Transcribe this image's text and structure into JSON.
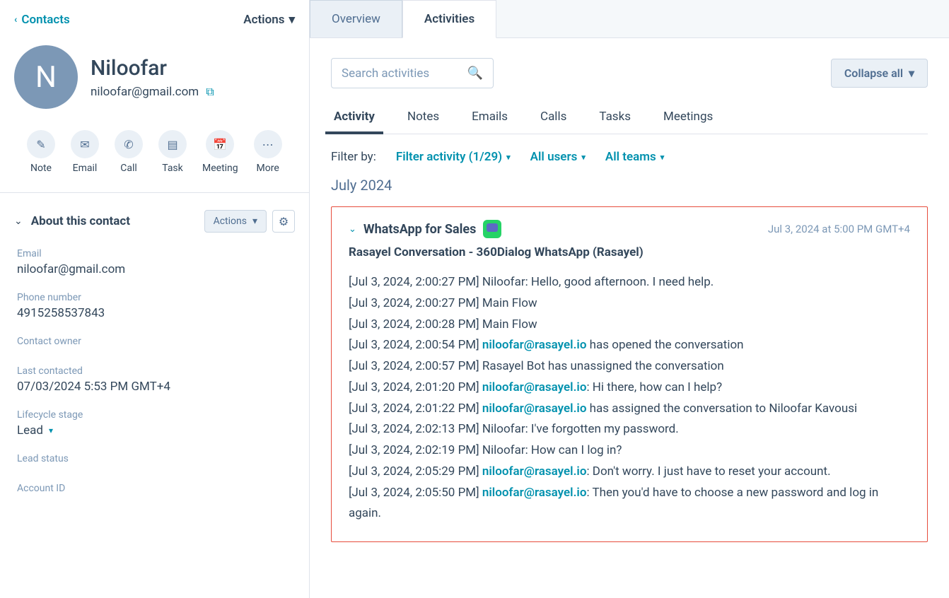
{
  "sidebar": {
    "back_label": "Contacts",
    "actions_label": "Actions",
    "avatar_letter": "N",
    "contact_name": "Niloofar",
    "contact_email": "niloofar@gmail.com",
    "action_buttons": [
      {
        "label": "Note",
        "icon": "✎"
      },
      {
        "label": "Email",
        "icon": "✉"
      },
      {
        "label": "Call",
        "icon": "✆"
      },
      {
        "label": "Task",
        "icon": "▤"
      },
      {
        "label": "Meeting",
        "icon": "📅"
      },
      {
        "label": "More",
        "icon": "⋯"
      }
    ],
    "about": {
      "title": "About this contact",
      "actions_label": "Actions",
      "fields": {
        "email_label": "Email",
        "email_value": "niloofar@gmail.com",
        "phone_label": "Phone number",
        "phone_value": "4915258537843",
        "owner_label": "Contact owner",
        "owner_value": "",
        "last_contacted_label": "Last contacted",
        "last_contacted_value": "07/03/2024 5:53 PM GMT+4",
        "lifecycle_label": "Lifecycle stage",
        "lifecycle_value": "Lead",
        "lead_status_label": "Lead status",
        "lead_status_value": "",
        "account_id_label": "Account ID"
      }
    }
  },
  "main": {
    "top_tabs": {
      "overview": "Overview",
      "activities": "Activities"
    },
    "search_placeholder": "Search activities",
    "collapse_label": "Collapse all",
    "sub_tabs": {
      "activity": "Activity",
      "notes": "Notes",
      "emails": "Emails",
      "calls": "Calls",
      "tasks": "Tasks",
      "meetings": "Meetings"
    },
    "filter": {
      "label": "Filter by:",
      "activity": "Filter activity (1/29)",
      "users": "All users",
      "teams": "All teams"
    },
    "month_header": "July 2024",
    "card": {
      "title": "WhatsApp for Sales",
      "date": "Jul 3, 2024 at 5:00 PM GMT+4",
      "subtitle": "Rasayel Conversation - 360Dialog WhatsApp (Rasayel)",
      "lines": [
        {
          "ts": "[Jul 3, 2024, 2:00:27 PM] ",
          "pre": "Niloofar: Hello, good afternoon. I need help."
        },
        {
          "ts": "[Jul 3, 2024, 2:00:27 PM] ",
          "pre": "Main Flow"
        },
        {
          "ts": "[Jul 3, 2024, 2:00:28 PM] ",
          "pre": "Main Flow"
        },
        {
          "ts": "[Jul 3, 2024, 2:00:54 PM] ",
          "link": "niloofar@rasayel.io",
          "post": " has opened the conversation"
        },
        {
          "ts": "[Jul 3, 2024, 2:00:57 PM] ",
          "pre": "Rasayel Bot has unassigned the conversation"
        },
        {
          "ts": "[Jul 3, 2024, 2:01:20 PM] ",
          "link": "niloofar@rasayel.io",
          "post": ": Hi there, how can I help?"
        },
        {
          "ts": "[Jul 3, 2024, 2:01:22 PM] ",
          "link": "niloofar@rasayel.io",
          "post": " has assigned the conversation to Niloofar Kavousi"
        },
        {
          "ts": "[Jul 3, 2024, 2:02:13 PM] ",
          "pre": "Niloofar: I've forgotten my password."
        },
        {
          "ts": "[Jul 3, 2024, 2:02:19 PM] ",
          "pre": "Niloofar: How can I log in?"
        },
        {
          "ts": "[Jul 3, 2024, 2:05:29 PM] ",
          "link": "niloofar@rasayel.io",
          "post": ": Don't worry. I just have to reset your account."
        },
        {
          "ts": "[Jul 3, 2024, 2:05:50 PM] ",
          "link": "niloofar@rasayel.io",
          "post": ": Then you'd have to choose a new password and log in again."
        }
      ]
    }
  }
}
